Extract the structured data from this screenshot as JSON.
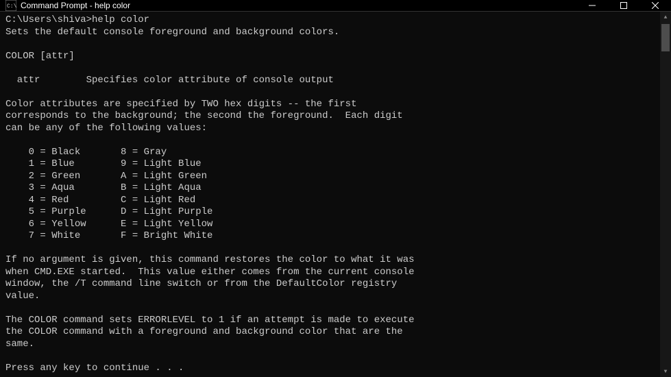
{
  "window": {
    "title": "Command Prompt - help  color"
  },
  "terminal": {
    "prompt": "C:\\Users\\shiva>",
    "command": "help color",
    "output_desc": "Sets the default console foreground and background colors.",
    "syntax": "COLOR [attr]",
    "attr_label": "  attr        Specifies color attribute of console output",
    "explain1": "Color attributes are specified by TWO hex digits -- the first",
    "explain2": "corresponds to the background; the second the foreground.  Each digit",
    "explain3": "can be any of the following values:",
    "colors": [
      "    0 = Black       8 = Gray",
      "    1 = Blue        9 = Light Blue",
      "    2 = Green       A = Light Green",
      "    3 = Aqua        B = Light Aqua",
      "    4 = Red         C = Light Red",
      "    5 = Purple      D = Light Purple",
      "    6 = Yellow      E = Light Yellow",
      "    7 = White       F = Bright White"
    ],
    "noarg1": "If no argument is given, this command restores the color to what it was",
    "noarg2": "when CMD.EXE started.  This value either comes from the current console",
    "noarg3": "window, the /T command line switch or from the DefaultColor registry",
    "noarg4": "value.",
    "error1": "The COLOR command sets ERRORLEVEL to 1 if an attempt is made to execute",
    "error2": "the COLOR command with a foreground and background color that are the",
    "error3": "same.",
    "continue": "Press any key to continue . . ."
  }
}
